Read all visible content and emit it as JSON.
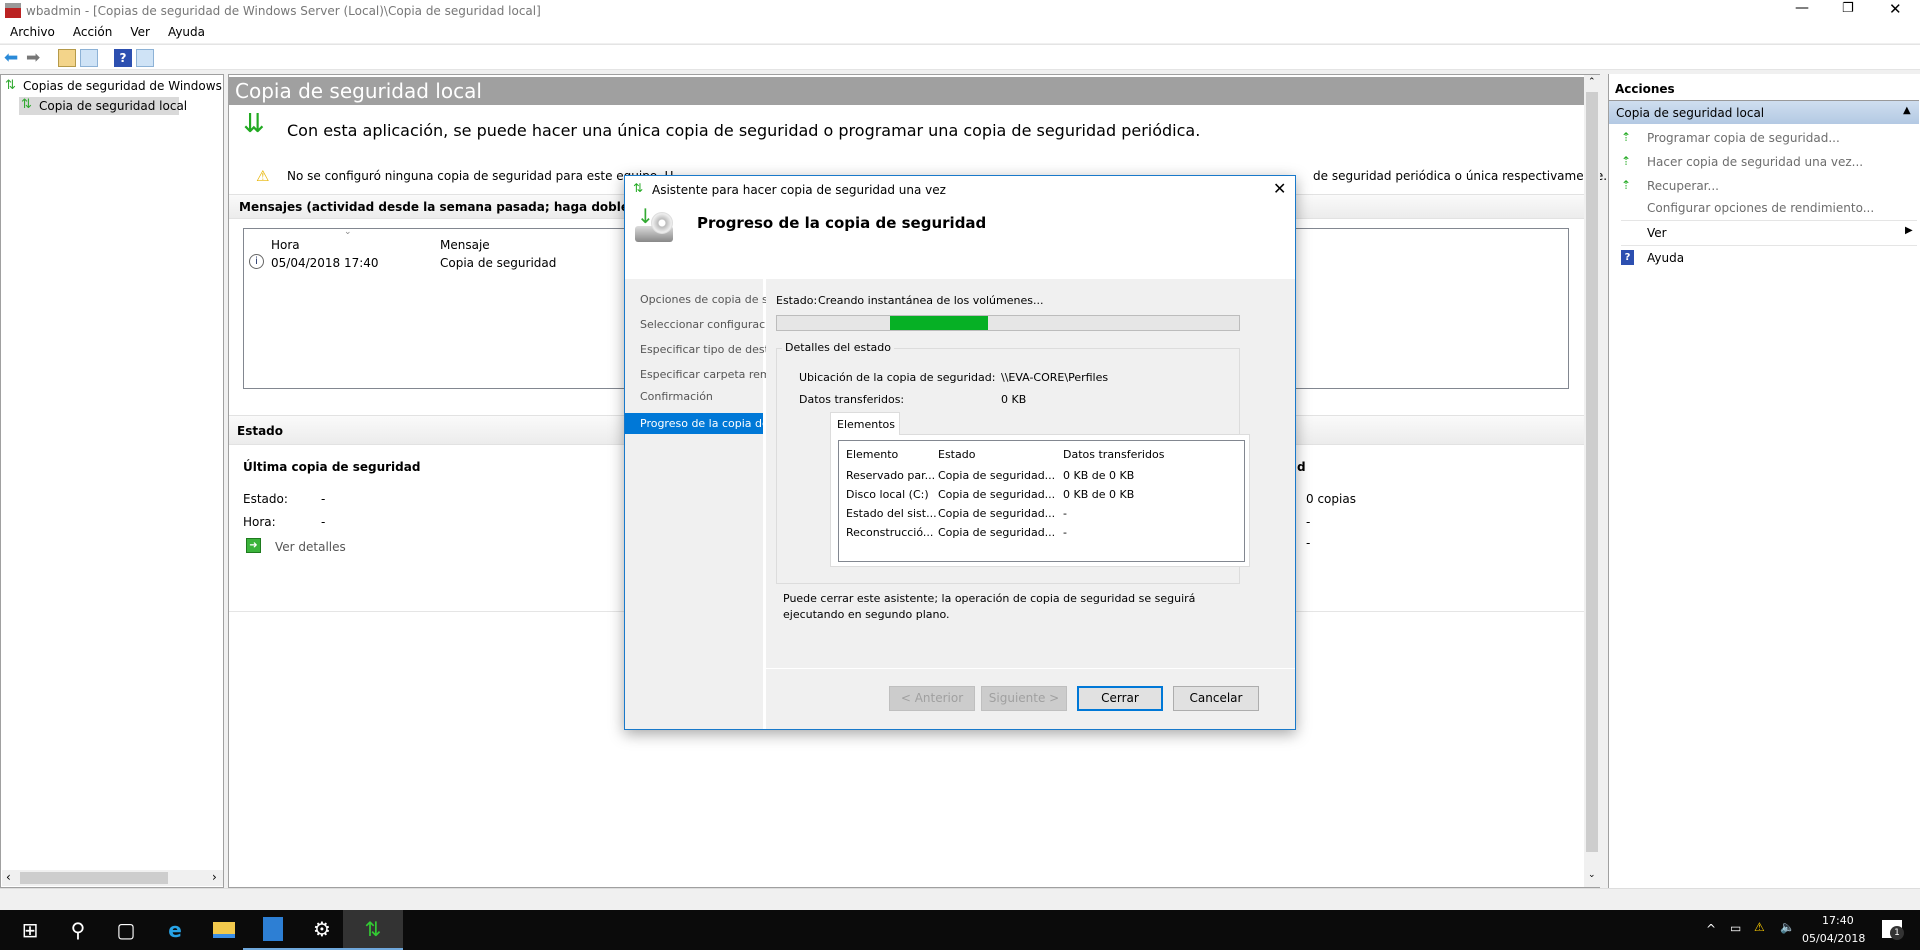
{
  "window": {
    "title": "wbadmin - [Copias de seguridad de Windows Server (Local)\\Copia de seguridad local]"
  },
  "menu": [
    "Archivo",
    "Acción",
    "Ver",
    "Ayuda"
  ],
  "tree": {
    "root": "Copias de seguridad de Windows Server (Local)",
    "child": "Copia de seguridad local"
  },
  "center": {
    "title": "Copia de seguridad local",
    "intro": "Con esta aplicación, se puede hacer una única copia de seguridad o programar una copia de seguridad periódica.",
    "warning_start": "No se configuró ninguna copia de seguridad para este equipo. U",
    "warning_end": "de seguridad periódica o única respectivamente.",
    "messages_header": "Mensajes (actividad desde la semana pasada; haga doble clic en el m",
    "messages_columns": [
      "Hora",
      "Mensaje"
    ],
    "messages": [
      {
        "time": "05/04/2018 17:40",
        "message": "Copia de seguridad"
      }
    ],
    "status_header": "Estado",
    "last_backup_title": "Última copia de seguridad",
    "last_backup": {
      "estado_label": "Estado:",
      "estado_value": "-",
      "hora_label": "Hora:",
      "hora_value": "-",
      "details_link": "Ver detalles"
    },
    "right_col_title_tail": "d",
    "right_col": [
      "0 copias",
      "-",
      "-"
    ]
  },
  "actions": {
    "header": "Acciones",
    "group": "Copia de seguridad local",
    "items": [
      "Programar copia de seguridad...",
      "Hacer copia de seguridad una vez...",
      "Recuperar...",
      "Configurar opciones de rendimiento..."
    ],
    "ver": "Ver",
    "ayuda": "Ayuda"
  },
  "dialog": {
    "title": "Asistente para hacer copia de seguridad una vez",
    "heading": "Progreso de la copia de seguridad",
    "steps": [
      "Opciones de copia de seg...",
      "Seleccionar configuració...",
      "Especificar tipo de destino",
      "Especificar carpeta remota",
      "Confirmación",
      "Progreso de la copia de s..."
    ],
    "status_label": "Estado:",
    "status_value": "Creando instantánea de los volúmenes...",
    "progress_indeterminate": true,
    "details_group": "Detalles del estado",
    "location_label": "Ubicación de la copia de seguridad:",
    "location_value": "\\\\EVA-CORE\\Perfiles",
    "transferred_label": "Datos transferidos:",
    "transferred_value": "0 KB",
    "tab": "Elementos",
    "columns": [
      "Elemento",
      "Estado",
      "Datos transferidos"
    ],
    "rows": [
      [
        "Reservado par...",
        "Copia de seguridad...",
        "0 KB de 0 KB"
      ],
      [
        "Disco local (C:)",
        "Copia de seguridad...",
        "0 KB de 0 KB"
      ],
      [
        "Estado del sist...",
        "Copia de seguridad...",
        "-"
      ],
      [
        "Reconstrucció...",
        "Copia de seguridad...",
        "-"
      ]
    ],
    "note": "Puede cerrar este asistente; la operación de copia de seguridad se seguirá ejecutando en segundo plano.",
    "buttons": {
      "back": "< Anterior",
      "next": "Siguiente >",
      "close": "Cerrar",
      "cancel": "Cancelar"
    }
  },
  "tray": {
    "time": "17:40",
    "date": "05/04/2018",
    "notifications": "1"
  },
  "colors": {
    "accent": "#0078d7",
    "progress": "#06b025",
    "header_gray": "#a0a0a0"
  }
}
